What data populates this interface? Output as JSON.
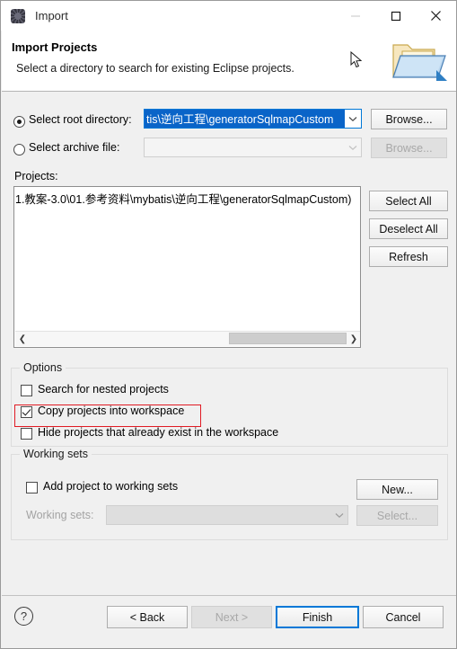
{
  "window": {
    "title": "Import",
    "icon": "eclipse-gear-icon",
    "controls": {
      "minimize": "minimize-icon",
      "maximize": "maximize-icon",
      "close": "close-icon"
    }
  },
  "header": {
    "title": "Import Projects",
    "description": "Select a directory to search for existing Eclipse projects.",
    "icon": "open-folder-icon"
  },
  "source": {
    "root_directory": {
      "label": "Select root directory:",
      "selected": true,
      "value": "tis\\逆向工程\\generatorSqlmapCustom",
      "text_selected": true,
      "browse_label": "Browse...",
      "browse_enabled": true
    },
    "archive_file": {
      "label": "Select archive file:",
      "selected": false,
      "value": "",
      "browse_label": "Browse...",
      "browse_enabled": false
    }
  },
  "projects": {
    "label": "Projects:",
    "items": [
      "1.教案-3.0\\01.参考资料\\mybatis\\逆向工程\\generatorSqlmapCustom)"
    ],
    "scroll": {
      "left_arrow": "chevron-left-icon",
      "right_arrow": "chevron-right-icon",
      "thumb_position": "right"
    },
    "buttons": [
      {
        "label": "Select All",
        "enabled": true
      },
      {
        "label": "Deselect All",
        "enabled": true
      },
      {
        "label": "Refresh",
        "enabled": true
      }
    ]
  },
  "options": {
    "title": "Options",
    "items": [
      {
        "label": "Search for nested projects",
        "checked": false,
        "highlighted": false
      },
      {
        "label": "Copy projects into workspace",
        "checked": true,
        "highlighted": true
      },
      {
        "label": "Hide projects that already exist in the workspace",
        "checked": false,
        "highlighted": false
      }
    ]
  },
  "working_sets": {
    "title": "Working sets",
    "add_checkbox": {
      "label": "Add project to working sets",
      "checked": false
    },
    "new_button": {
      "label": "New...",
      "enabled": true
    },
    "sets_label": "Working sets:",
    "sets_value": "",
    "select_button": {
      "label": "Select...",
      "enabled": false
    }
  },
  "footer": {
    "help": "help-icon",
    "buttons": [
      {
        "label": "< Back",
        "enabled": true,
        "default": false
      },
      {
        "label": "Next >",
        "enabled": false,
        "default": false
      },
      {
        "label": "Finish",
        "enabled": true,
        "default": true
      },
      {
        "label": "Cancel",
        "enabled": true,
        "default": false
      }
    ]
  },
  "colors": {
    "accent": "#0078d7",
    "selection": "#0a64c8",
    "annotation": "#e01b24",
    "dialog_bg": "#f0f0f0"
  }
}
